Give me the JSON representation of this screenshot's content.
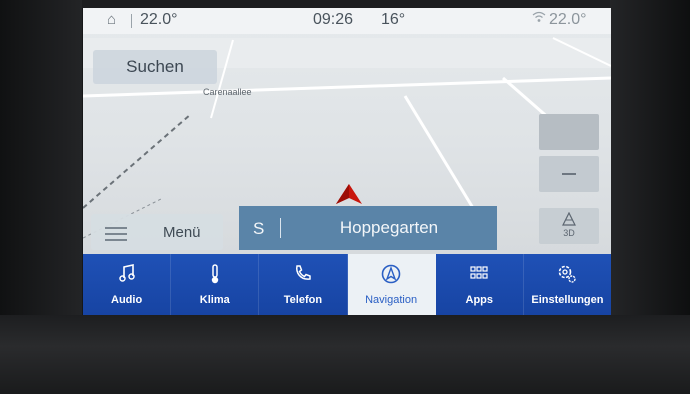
{
  "status_bar": {
    "home_icon": "home-icon",
    "inside_temp": "22.0°",
    "clock": "09:26",
    "outside_temp": "16°",
    "wifi_icon": "wifi-icon",
    "right_temp": "22.0°"
  },
  "map": {
    "search_label": "Suchen",
    "street_label": "Carenaallee",
    "vehicle_icon": "vehicle-position-arrow-icon",
    "vehicle_color": "#c8160c"
  },
  "controls": {
    "zoom_out_icon": "minus-icon",
    "view_mode_label": "3D"
  },
  "bottom": {
    "menu_label": "Menü",
    "route": {
      "direction": "S",
      "street": "Hoppegarten"
    }
  },
  "nav_tabs": [
    {
      "label": "Audio",
      "icon": "music-note-icon"
    },
    {
      "label": "Klima",
      "icon": "thermometer-icon"
    },
    {
      "label": "Telefon",
      "icon": "phone-icon"
    },
    {
      "label": "Navigation",
      "icon": "navigation-icon",
      "active": true
    },
    {
      "label": "Apps",
      "icon": "apps-grid-icon"
    },
    {
      "label": "Einstellungen",
      "icon": "gear-icon"
    }
  ],
  "colors": {
    "nav_bar": "#1f51b6",
    "route_bar": "#5a84a8",
    "active_tab": "#ecf1f5"
  }
}
